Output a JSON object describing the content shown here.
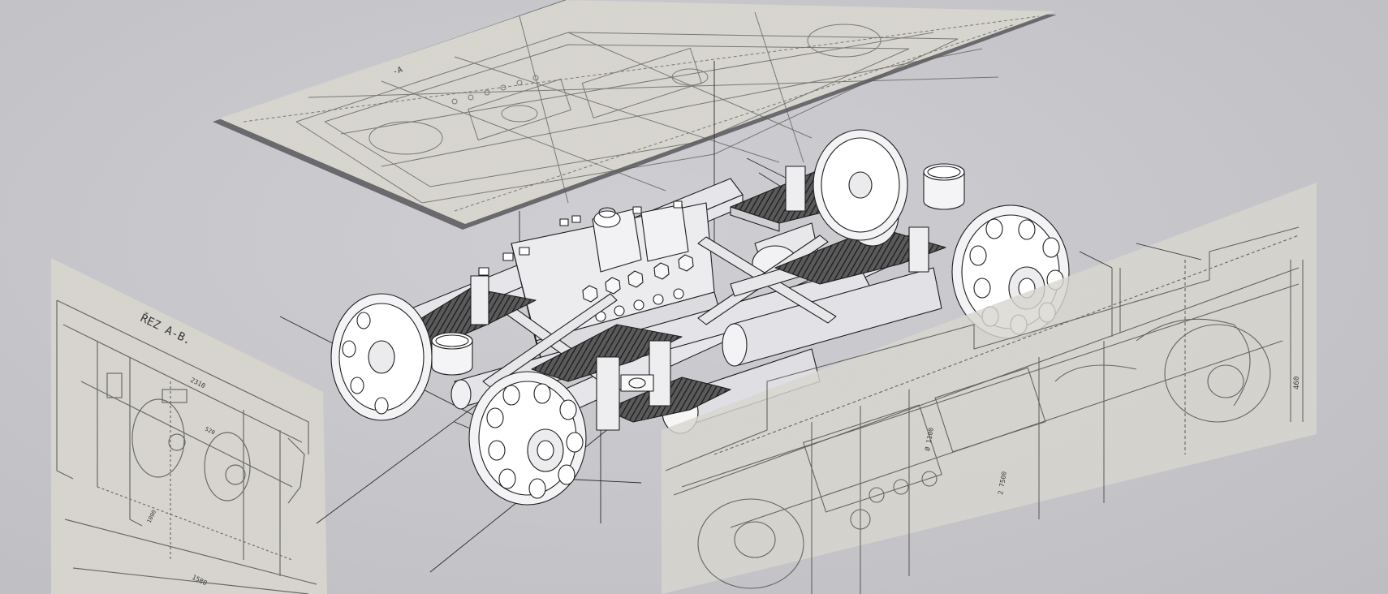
{
  "scene": {
    "palette": {
      "background": "#c7c7cb",
      "paper": "#dcdad4",
      "paper_shadow": "#6a6a6e",
      "ink": "#4b4b4b",
      "model_line": "#1e1e1e",
      "model_fill": "#e9e9ec",
      "spring_dark": "#3a3a3a"
    },
    "left_sheet": {
      "section_label": "ŘEZ A-B.",
      "dim_top": "2310",
      "dim_bottom": "1580",
      "dim_mid": "520",
      "dim_side": "1000"
    },
    "right_sheet": {
      "dim_height": "460",
      "dim_axle": "Ø 1100",
      "dim_base": "2 7500"
    },
    "top_sheet": {
      "label": "-A"
    }
  }
}
